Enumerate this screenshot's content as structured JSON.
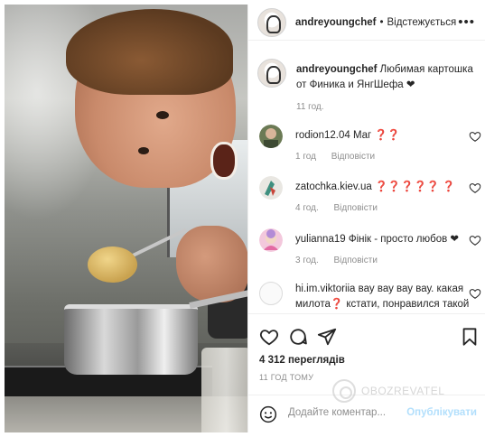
{
  "post": {
    "username": "andreyoungchef",
    "separator": "•",
    "follow_status": "Відстежується",
    "more_label": "•••"
  },
  "caption": {
    "username": "andreyoungchef",
    "text": "Любимая картошка от Финика и ЯнгШефа ❤",
    "time": "11 год."
  },
  "comments": [
    {
      "username": "rodion12.04",
      "text": "Маг ❓❓",
      "time": "1 год",
      "reply_label": "Відповісти"
    },
    {
      "username": "zatochka.kiev.ua",
      "text": "❓❓❓❓❓ ❓",
      "time": "4 год.",
      "reply_label": "Відповісти"
    },
    {
      "username": "yulianna19",
      "text": "Фінік - просто любов ❤",
      "time": "3 год.",
      "reply_label": "Відповісти"
    },
    {
      "username": "hi.im.viktoriia",
      "text": "вау вау вау вау. какая милота❓ кстати, понравился такой"
    }
  ],
  "stats": {
    "views": "4 312 переглядів",
    "posted": "11 ГОД ТОМУ"
  },
  "comment_box": {
    "placeholder": "Додайте коментар...",
    "post_label": "Опублікувати"
  },
  "watermark": "OBOZREVATEL",
  "icons": {
    "more": "more-dots-icon",
    "like": "heart-icon",
    "comment": "comment-icon",
    "share": "share-icon",
    "save": "bookmark-icon",
    "emoji": "smile-icon"
  }
}
